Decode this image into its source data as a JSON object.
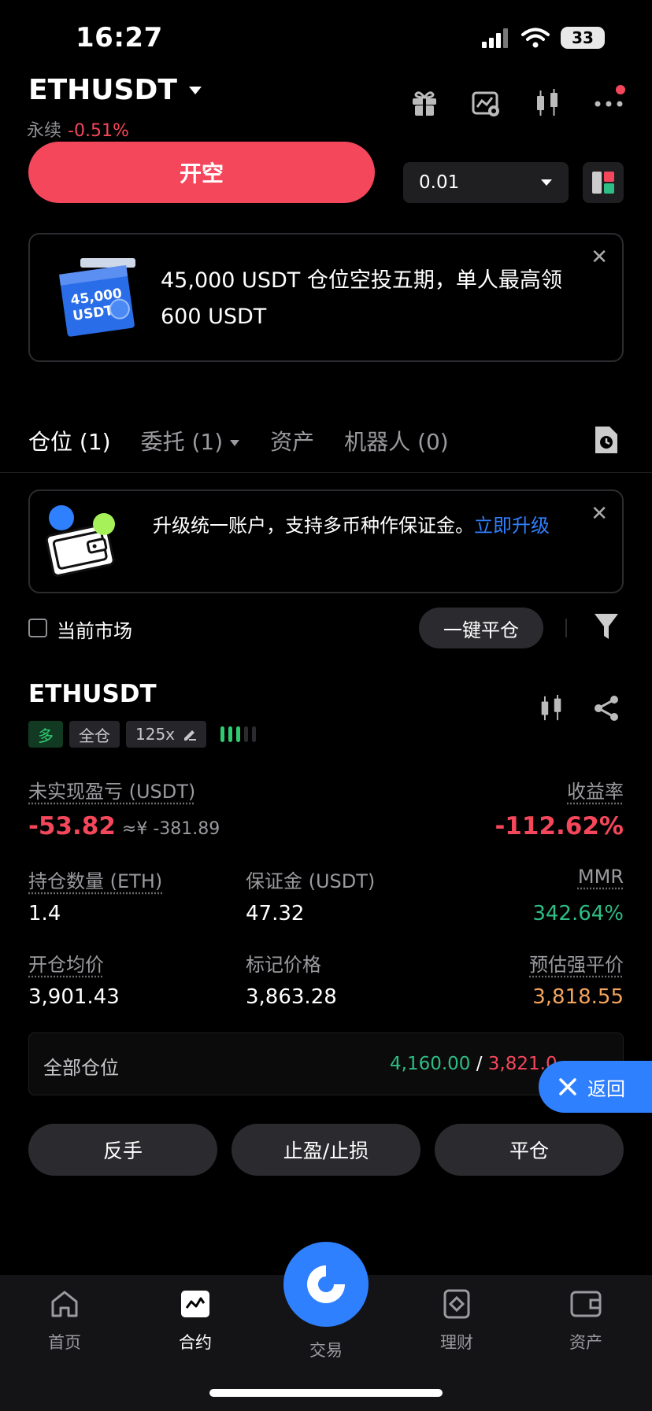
{
  "status_bar": {
    "time": "16:27",
    "battery": "33"
  },
  "header": {
    "pair": "ETHUSDT",
    "contract_type": "永续",
    "change": "-0.51%"
  },
  "order": {
    "short_label": "开空",
    "quantity": "0.01"
  },
  "promo": {
    "badge_amount": "45,000",
    "badge_unit": "USDT",
    "text": "45,000 USDT 仓位空投五期，单人最高领 600 USDT"
  },
  "tabs": [
    {
      "label": "仓位 (1)"
    },
    {
      "label": "委托 (1)"
    },
    {
      "label": "资产"
    },
    {
      "label": "机器人 (0)"
    }
  ],
  "upgrade": {
    "text": "升级统一账户，支持多币种作保证金。",
    "link": "立即升级"
  },
  "filter": {
    "current_market": "当前市场",
    "close_all": "一键平仓"
  },
  "position": {
    "symbol": "ETHUSDT",
    "side": "多",
    "margin_mode": "全仓",
    "leverage": "125x",
    "unrealized_pnl_label": "未实现盈亏 (USDT)",
    "unrealized_pnl": "-53.82",
    "unrealized_pnl_cny": "≈¥ -381.89",
    "roe_label": "收益率",
    "roe": "-112.62%",
    "size_label": "持仓数量 (ETH)",
    "size": "1.4",
    "margin_label": "保证金 (USDT)",
    "margin": "47.32",
    "mmr_label": "MMR",
    "mmr": "342.64%",
    "entry_label": "开仓均价",
    "entry": "3,901.43",
    "mark_label": "标记价格",
    "mark": "3,863.28",
    "liq_label": "预估强平价",
    "liq": "3,818.55"
  },
  "all_positions": {
    "label": "全部仓位",
    "green_value": "4,160.00",
    "separator": "/",
    "red_value": "3,821.0"
  },
  "back_button": "返回",
  "actions": {
    "reverse": "反手",
    "tp_sl": "止盈/止损",
    "close": "平仓"
  },
  "nav": [
    {
      "label": "首页"
    },
    {
      "label": "合约"
    },
    {
      "label": "交易"
    },
    {
      "label": "理财"
    },
    {
      "label": "资产"
    }
  ],
  "colors": {
    "red": "#f5475c",
    "green": "#2ebd85",
    "blue": "#2f80ff",
    "orange": "#f2a45c"
  }
}
